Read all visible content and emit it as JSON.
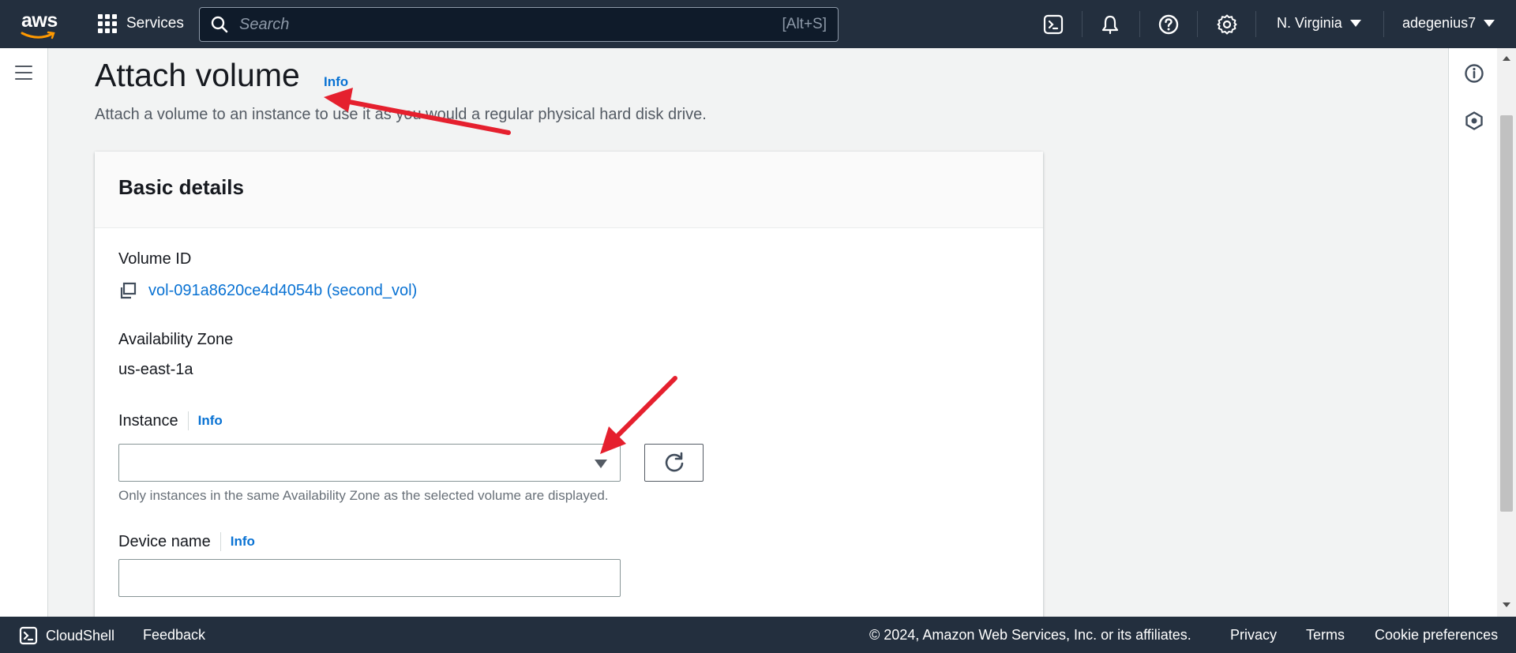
{
  "topnav": {
    "logo_text": "aws",
    "services_label": "Services",
    "search_placeholder": "Search",
    "search_shortcut": "[Alt+S]",
    "region_label": "N. Virginia",
    "user_label": "adegenius7"
  },
  "page": {
    "title": "Attach volume",
    "title_info": "Info",
    "description": "Attach a volume to an instance to use it as you would a regular physical hard disk drive."
  },
  "panel": {
    "title": "Basic details",
    "volume_id_label": "Volume ID",
    "volume_id_value": "vol-091a8620ce4d4054b (second_vol)",
    "az_label": "Availability Zone",
    "az_value": "us-east-1a",
    "instance_label": "Instance",
    "instance_info": "Info",
    "instance_hint": "Only instances in the same Availability Zone as the selected volume are displayed.",
    "device_label": "Device name",
    "device_info": "Info"
  },
  "footer": {
    "cloudshell": "CloudShell",
    "feedback": "Feedback",
    "copyright": "© 2024, Amazon Web Services, Inc. or its affiliates.",
    "privacy": "Privacy",
    "terms": "Terms",
    "cookie": "Cookie preferences"
  },
  "colors": {
    "nav_bg": "#232f3e",
    "link": "#0972d3",
    "annotation": "#e5202e",
    "logo_smile": "#ff9900"
  },
  "icons": [
    "grid-icon",
    "search-icon",
    "cloudshell-icon",
    "bell-icon",
    "help-icon",
    "gear-icon",
    "menu-icon",
    "info-circle-icon",
    "hexagon-icon",
    "copy-icon",
    "refresh-icon",
    "caret-down-icon"
  ]
}
